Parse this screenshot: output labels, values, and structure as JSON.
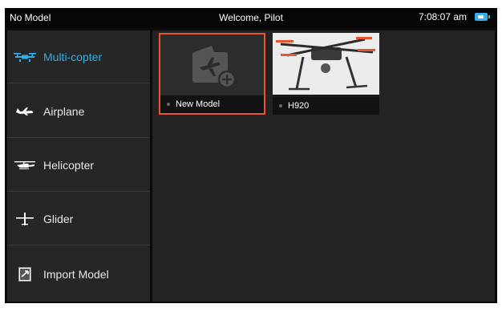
{
  "status_bar": {
    "model": "No Model",
    "welcome": "Welcome, Pilot",
    "time": "7:08:07 am",
    "battery_icon": "battery-icon"
  },
  "sidebar": {
    "items": [
      {
        "label": "Multi-copter",
        "icon": "multicopter-icon",
        "active": true
      },
      {
        "label": "Airplane",
        "icon": "airplane-icon",
        "active": false
      },
      {
        "label": "Helicopter",
        "icon": "helicopter-icon",
        "active": false
      },
      {
        "label": "Glider",
        "icon": "glider-icon",
        "active": false
      },
      {
        "label": "Import Model",
        "icon": "import-model-icon",
        "active": false
      }
    ]
  },
  "models": [
    {
      "label": "New Model",
      "icon": "new-model-icon",
      "selected": true
    },
    {
      "label": "H920",
      "icon": "drone-photo",
      "selected": false
    }
  ],
  "colors": {
    "accent": "#2fb0ea",
    "selection": "#e8552e"
  }
}
